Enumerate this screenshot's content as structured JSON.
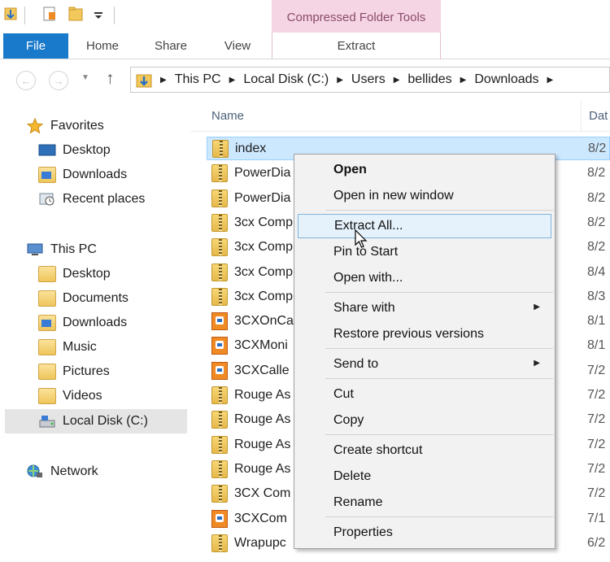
{
  "titlebar": {
    "contextual_group": "Compressed Folder Tools"
  },
  "ribbon": {
    "tabs": [
      "File",
      "Home",
      "Share",
      "View"
    ],
    "contextual_tab": "Extract"
  },
  "address": {
    "segments": [
      "This PC",
      "Local Disk (C:)",
      "Users",
      "bellides",
      "Downloads"
    ]
  },
  "sidebar": {
    "favorites": {
      "label": "Favorites",
      "items": [
        "Desktop",
        "Downloads",
        "Recent places"
      ]
    },
    "this_pc": {
      "label": "This PC",
      "items": [
        "Desktop",
        "Documents",
        "Downloads",
        "Music",
        "Pictures",
        "Videos",
        "Local Disk (C:)"
      ]
    },
    "network": {
      "label": "Network"
    }
  },
  "columns": {
    "name": "Name",
    "date": "Dat"
  },
  "files": [
    {
      "name": "index",
      "date": "8/2",
      "icon": "zip-folder-icon",
      "selected": true
    },
    {
      "name": "PowerDia",
      "date": "8/2",
      "icon": "zip-folder-icon"
    },
    {
      "name": "PowerDia",
      "date": "8/2",
      "icon": "zip-folder-icon"
    },
    {
      "name": "3cx Comp",
      "date": "8/2",
      "icon": "zip-folder-icon"
    },
    {
      "name": "3cx Comp",
      "date": "8/2",
      "icon": "zip-folder-icon"
    },
    {
      "name": "3cx Comp",
      "date": "8/4",
      "icon": "zip-folder-icon"
    },
    {
      "name": "3cx Comp",
      "date": "8/3",
      "icon": "zip-folder-icon"
    },
    {
      "name": "3CXOnCa",
      "date": "8/1",
      "icon": "installer-icon"
    },
    {
      "name": "3CXMoni",
      "date": "8/1",
      "icon": "installer-icon"
    },
    {
      "name": "3CXCalle",
      "date": "7/2",
      "icon": "installer-icon"
    },
    {
      "name": "Rouge As",
      "date": "7/2",
      "icon": "zip-folder-icon"
    },
    {
      "name": "Rouge As",
      "date": "7/2",
      "icon": "zip-folder-icon"
    },
    {
      "name": "Rouge As",
      "date": "7/2",
      "icon": "zip-folder-icon"
    },
    {
      "name": "Rouge As",
      "date": "7/2",
      "icon": "zip-folder-icon"
    },
    {
      "name": "3CX Com",
      "date": "7/2",
      "icon": "zip-folder-icon"
    },
    {
      "name": "3CXCom",
      "date": "7/1",
      "icon": "installer-icon"
    },
    {
      "name": "Wrapupc",
      "date": "6/2",
      "icon": "zip-folder-icon"
    }
  ],
  "context_menu": {
    "items": [
      {
        "label": "Open",
        "bold": true
      },
      {
        "label": "Open in new window"
      },
      {
        "sep": true
      },
      {
        "label": "Extract All...",
        "hover": true
      },
      {
        "label": "Pin to Start"
      },
      {
        "label": "Open with..."
      },
      {
        "sep": true
      },
      {
        "label": "Share with",
        "submenu": true
      },
      {
        "label": "Restore previous versions"
      },
      {
        "sep": true
      },
      {
        "label": "Send to",
        "submenu": true
      },
      {
        "sep": true
      },
      {
        "label": "Cut"
      },
      {
        "label": "Copy"
      },
      {
        "sep": true
      },
      {
        "label": "Create shortcut"
      },
      {
        "label": "Delete"
      },
      {
        "label": "Rename"
      },
      {
        "sep": true
      },
      {
        "label": "Properties"
      }
    ]
  },
  "colors": {
    "file_tab": "#1979ca",
    "contextual_tab": "#f5d5e4",
    "selection": "#cce8ff",
    "menu_hover": "#e5f1fb"
  }
}
